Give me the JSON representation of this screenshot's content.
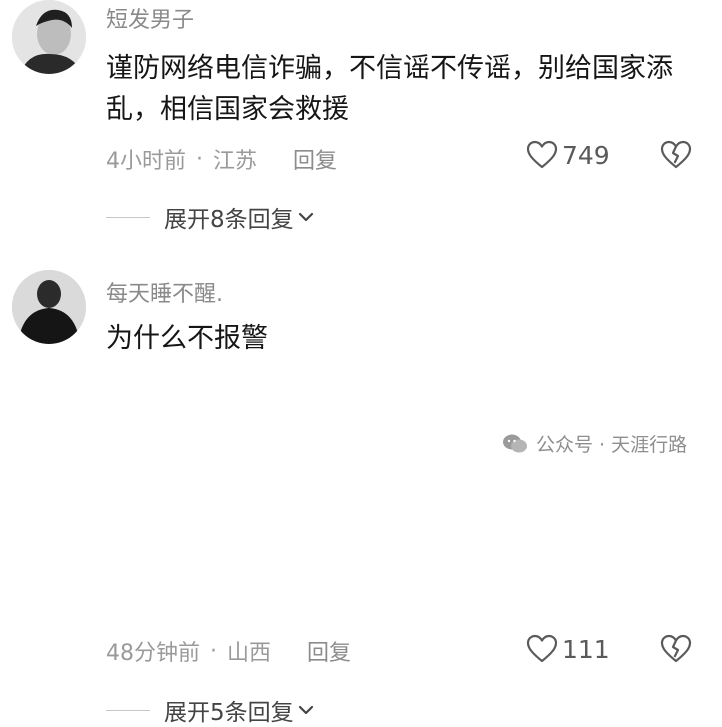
{
  "comments": [
    {
      "username": "短发男子",
      "content": "谨防网络电信诈骗，不信谣不传谣，别给国家添乱，相信国家会救援",
      "time": "4小时前",
      "location": "江苏",
      "reply_label": "回复",
      "likes": "749",
      "expand_label": "展开8条回复"
    },
    {
      "username": "每天睡不醒.",
      "content": "为什么不报警",
      "time": "48分钟前",
      "location": "山西",
      "reply_label": "回复",
      "likes": "111",
      "expand_label": "展开5条回复"
    }
  ],
  "separator": "·",
  "watermark": "公众号 · 天涯行路",
  "colors": {
    "text": "#161616",
    "secondary": "#9a9a9a",
    "icon": "#5a5a5a"
  }
}
